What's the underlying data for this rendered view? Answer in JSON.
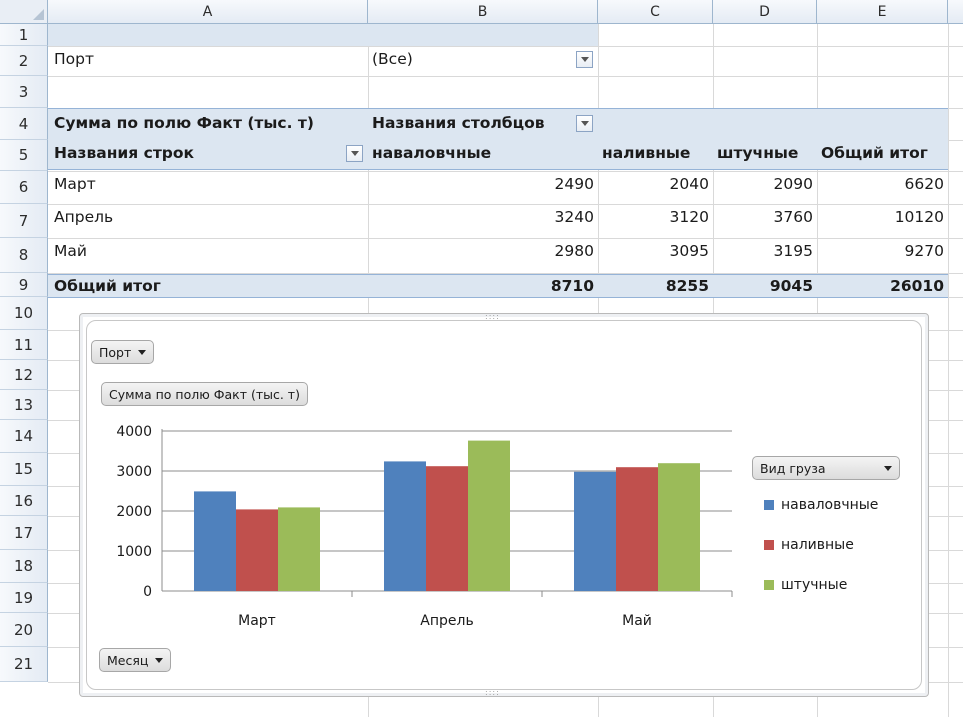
{
  "columns": [
    "A",
    "B",
    "C",
    "D",
    "E"
  ],
  "rows": [
    "1",
    "2",
    "3",
    "4",
    "5",
    "6",
    "7",
    "8",
    "9",
    "10",
    "11",
    "12",
    "13",
    "14",
    "15",
    "16",
    "17",
    "18",
    "19",
    "20",
    "21"
  ],
  "pivot": {
    "filter_label": "Порт",
    "filter_value": "(Все)",
    "value_field": "Сумма по полю Факт  (тыс. т)",
    "column_labels": "Названия столбцов",
    "row_labels": "Названия строк",
    "col_headers": [
      "наваловчные",
      "наливные",
      "штучные",
      "Общий итог"
    ],
    "data_rows": [
      {
        "label": "Март",
        "values": [
          "2490",
          "2040",
          "2090",
          "6620"
        ]
      },
      {
        "label": "Апрель",
        "values": [
          "3240",
          "3120",
          "3760",
          "10120"
        ]
      },
      {
        "label": "Май",
        "values": [
          "2980",
          "3095",
          "3195",
          "9270"
        ]
      }
    ],
    "total_row": {
      "label": "Общий итог",
      "values": [
        "8710",
        "8255",
        "9045",
        "26010"
      ]
    }
  },
  "chart_data": {
    "type": "bar",
    "categories": [
      "Март",
      "Апрель",
      "Май"
    ],
    "series": [
      {
        "name": "наваловчные",
        "values": [
          2490,
          3240,
          2980
        ],
        "color": "#4f81bd"
      },
      {
        "name": "наливные",
        "values": [
          2040,
          3120,
          3095
        ],
        "color": "#c0504d"
      },
      {
        "name": "штучные",
        "values": [
          2090,
          3760,
          3195
        ],
        "color": "#9bbb59"
      }
    ],
    "y_ticks": [
      "0",
      "1000",
      "2000",
      "3000",
      "4000"
    ],
    "ylim": [
      0,
      4000
    ],
    "grid": true,
    "legend_position": "right",
    "filter_button": "Порт",
    "value_button": "Сумма по полю Факт  (тыс. т)",
    "legend_button": "Вид груза",
    "axis_button": "Месяц",
    "handle": "::::"
  }
}
